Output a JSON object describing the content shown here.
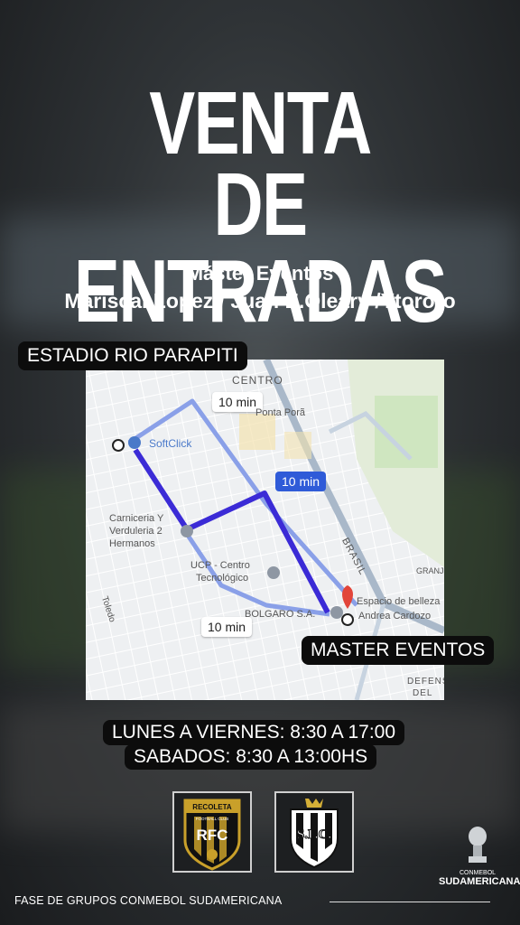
{
  "header": {
    "title_line1": "VENTA",
    "title_line2": "DE ENTRADAS",
    "subtitle_line1": "Máster Eventos",
    "subtitle_line2": "Mariscal Lopez / Juan E.Óleary /Ytororo"
  },
  "labels": {
    "origin": "ESTADIO RIO PARAPITI",
    "destination": "MASTER EVENTOS"
  },
  "map": {
    "route_times": [
      "10 min",
      "10 min",
      "10 min"
    ],
    "places": {
      "centro": "CENTRO",
      "ponta_pora": "Ponta Porã",
      "softclick": "SoftClick",
      "carniceria_1": "Carniceria Y",
      "carniceria_2": "Verduleria 2",
      "carniceria_3": "Hermanos",
      "ucp_1": "UCP - Centro",
      "ucp_2": "Tecnológico",
      "bolgaro": "BOLGARO S.A.",
      "espacio_1": "Espacio de belleza",
      "espacio_2": "Andrea Cardozo",
      "brasil": "BRASIL",
      "granja": "GRANJ",
      "toledo": "Toledo",
      "defens": "DEFENS",
      "del_ch": "DEL CH"
    },
    "route_color": "#3b2bd6",
    "alt_route_color": "#8aa0e8"
  },
  "schedule": {
    "weekdays": "LUNES A VIERNES: 8:30 A 17:00",
    "saturday": "SABADOS: 8:30 A 13:00HS"
  },
  "logos": {
    "rfc_top": "RECOLETA",
    "rfc_sub": "FOOTBALL CLUB",
    "rfc_initials": "RFC",
    "sfc_initials": "S.F.C.",
    "conmebol_small": "CONMEBOL",
    "conmebol_big": "SUDAMERICANA"
  },
  "footer": {
    "text": "FASE DE GRUPOS CONMEBOL SUDAMERICANA"
  }
}
